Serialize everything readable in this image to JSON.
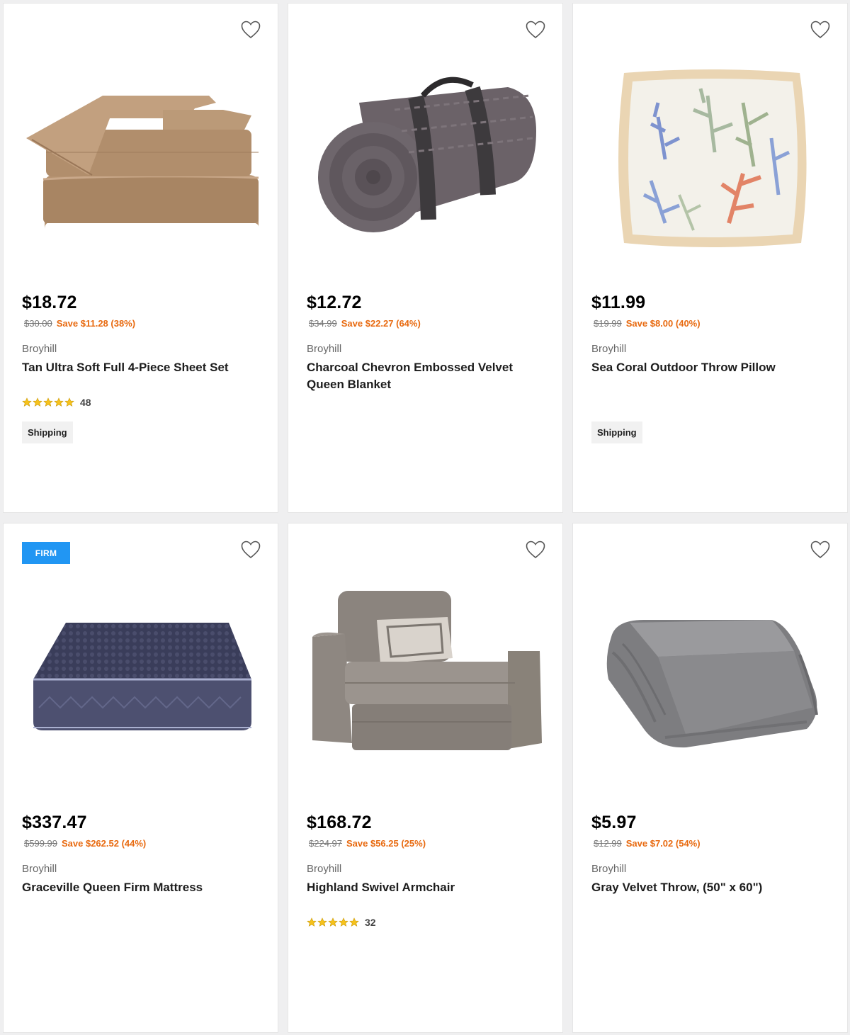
{
  "products": [
    {
      "price": "$18.72",
      "was": "$30.00",
      "save": "Save $11.28 (38%)",
      "brand": "Broyhill",
      "name": "Tan Ultra Soft Full 4-Piece Sheet Set",
      "rating_count": "48",
      "stars": 5,
      "tag": "Shipping",
      "image": "sheet-set-image"
    },
    {
      "price": "$12.72",
      "was": "$34.99",
      "save": "Save $22.27 (64%)",
      "brand": "Broyhill",
      "name": "Charcoal Chevron Embossed Velvet Queen Blanket",
      "image": "rolled-blanket-image"
    },
    {
      "price": "$11.99",
      "was": "$19.99",
      "save": "Save $8.00 (40%)",
      "brand": "Broyhill",
      "name": "Sea Coral Outdoor Throw Pillow",
      "tag": "Shipping",
      "image": "coral-pillow-image"
    },
    {
      "badge": "FIRM",
      "price": "$337.47",
      "was": "$599.99",
      "save": "Save $262.52 (44%)",
      "brand": "Broyhill",
      "name": "Graceville Queen Firm Mattress",
      "image": "mattress-image"
    },
    {
      "price": "$168.72",
      "was": "$224.97",
      "save": "Save $56.25 (25%)",
      "brand": "Broyhill",
      "name": "Highland Swivel Armchair",
      "rating_count": "32",
      "stars": 5,
      "image": "armchair-image"
    },
    {
      "price": "$5.97",
      "was": "$12.99",
      "save": "Save $7.02 (54%)",
      "brand": "Broyhill",
      "name": "Gray Velvet Throw, (50\" x 60\")",
      "image": "folded-throw-image"
    }
  ],
  "colors": {
    "save": "#e86a10",
    "badge": "#2196f3",
    "star": "#f6c21c"
  }
}
